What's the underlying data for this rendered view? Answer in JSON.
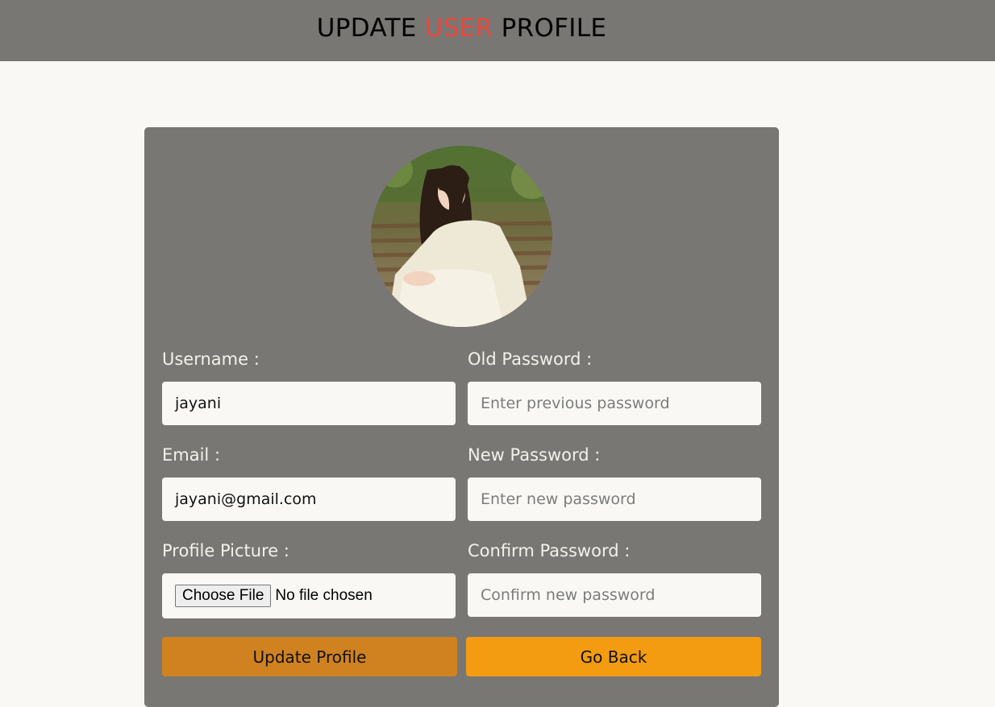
{
  "header": {
    "title_part1": "UPDATE ",
    "title_accent": "USER",
    "title_part2": " PROFILE",
    "accent_color": "#e8473c"
  },
  "form": {
    "username": {
      "label": "Username :",
      "value": "jayani"
    },
    "email": {
      "label": "Email :",
      "value": "jayani@gmail.com"
    },
    "profile_picture": {
      "label": "Profile Picture :",
      "button": "Choose File",
      "status": "No file chosen"
    },
    "old_password": {
      "label": "Old Password :",
      "placeholder": "Enter previous password"
    },
    "new_password": {
      "label": "New Password :",
      "placeholder": "Enter new password"
    },
    "confirm_password": {
      "label": "Confirm Password :",
      "placeholder": "Confirm new password"
    }
  },
  "actions": {
    "update_label": "Update Profile",
    "back_label": "Go Back",
    "update_color": "#d08221",
    "back_color": "#f39c12"
  },
  "avatar": {
    "icon": "profile-photo"
  }
}
